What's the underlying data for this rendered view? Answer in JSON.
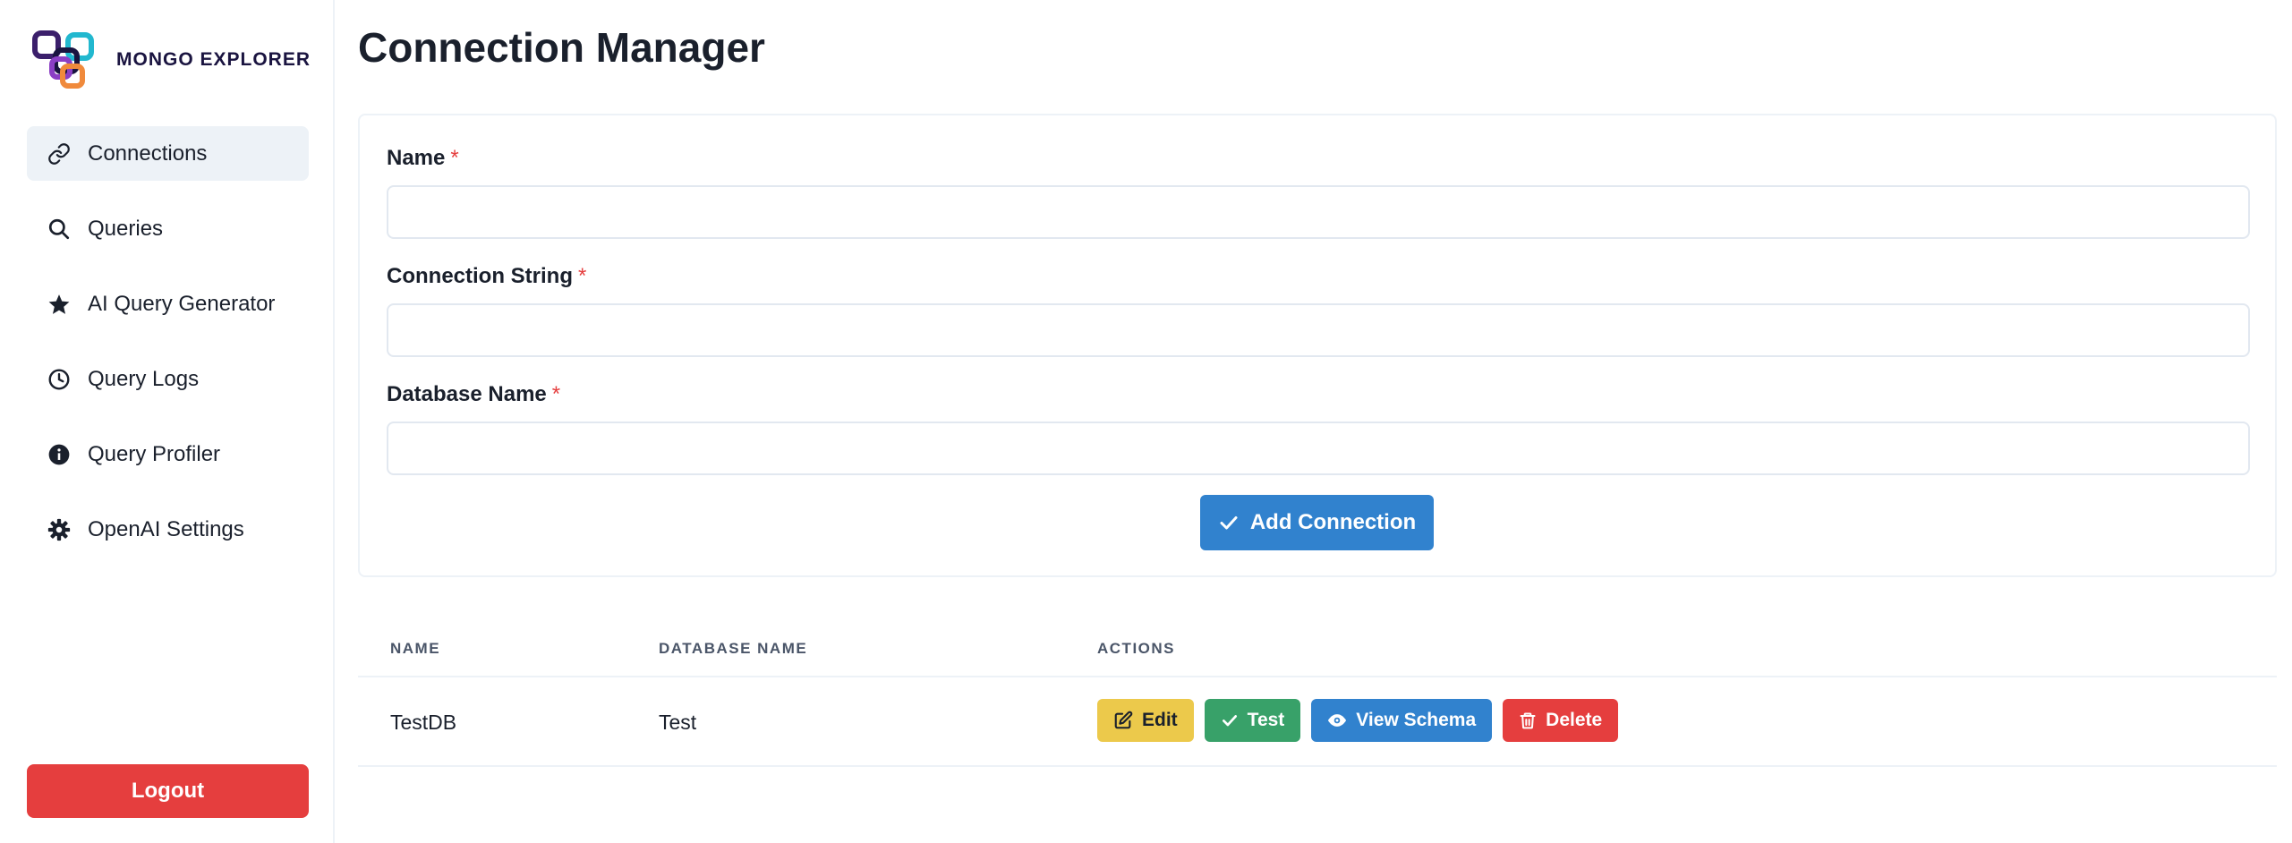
{
  "app": {
    "logo_text": "MONGO EXPLORER",
    "accent_color": "#3182ce",
    "danger_color": "#e53e3e"
  },
  "sidebar": {
    "items": [
      {
        "label": "Connections",
        "icon": "link-icon",
        "active": true
      },
      {
        "label": "Queries",
        "icon": "search-icon",
        "active": false
      },
      {
        "label": "AI Query Generator",
        "icon": "star-icon",
        "active": false
      },
      {
        "label": "Query Logs",
        "icon": "clock-icon",
        "active": false
      },
      {
        "label": "Query Profiler",
        "icon": "info-icon",
        "active": false
      },
      {
        "label": "OpenAI Settings",
        "icon": "gear-icon",
        "active": false
      }
    ],
    "logout_label": "Logout"
  },
  "main": {
    "title": "Connection Manager",
    "form": {
      "name_label": "Name",
      "name_value": "",
      "connection_string_label": "Connection String",
      "connection_string_value": "",
      "database_name_label": "Database Name",
      "database_name_value": "",
      "required_marker": "*",
      "submit_label": "Add Connection"
    },
    "table": {
      "headers": [
        "NAME",
        "DATABASE NAME",
        "ACTIONS"
      ],
      "rows": [
        {
          "name": "TestDB",
          "database": "Test"
        }
      ],
      "actions": {
        "edit": "Edit",
        "test": "Test",
        "view_schema": "View Schema",
        "delete": "Delete"
      }
    }
  }
}
